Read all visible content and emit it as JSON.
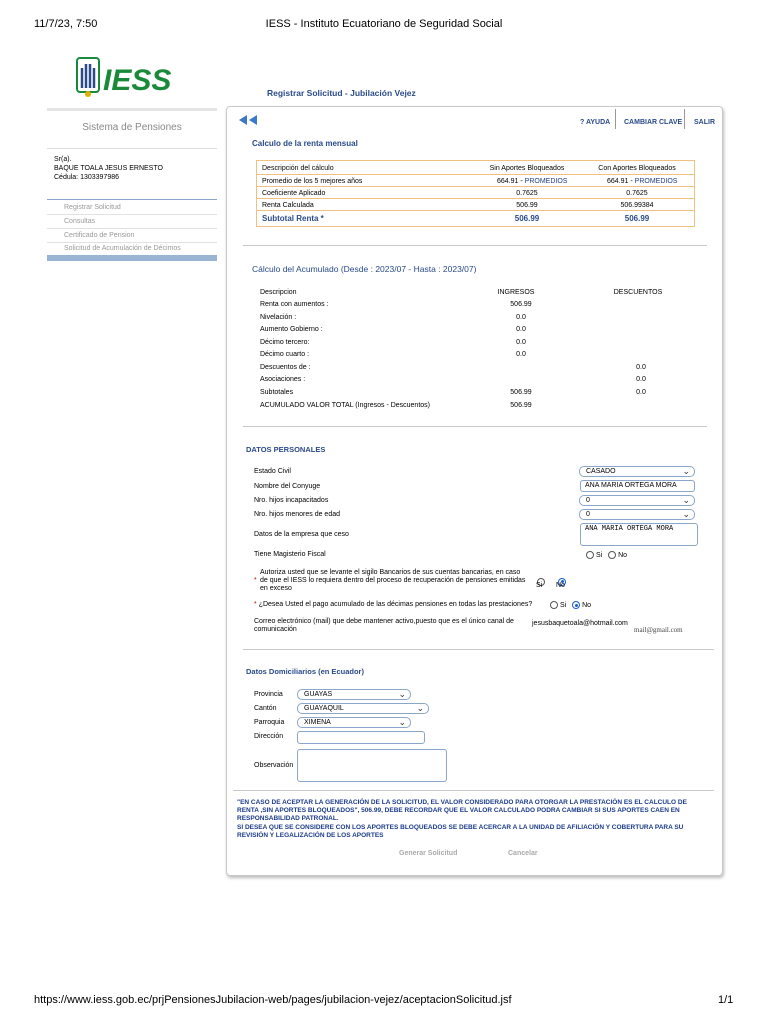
{
  "print_header": {
    "datetime": "11/7/23, 7:50",
    "title": "IESS - Instituto Ecuatoriano de Seguridad Social"
  },
  "print_footer": {
    "url": "https://www.iess.gob.ec/prjPensionesJubilacion-web/pages/jubilacion-vejez/aceptacionSolicitud.jsf",
    "page": "1/1"
  },
  "logo": {
    "text": "IESS"
  },
  "page_title": "Registrar Solicitud - Jubilación Vejez",
  "sidebar": {
    "system_name": "Sistema de Pensiones",
    "user_salutation": "Sr(a).",
    "user_name": "BAQUE TOALA JESUS ERNESTO",
    "user_id": "Cédula: 1303397986",
    "items": [
      {
        "label": "Registrar Solicitud"
      },
      {
        "label": "Consultas"
      },
      {
        "label": "Certificado de Pension"
      },
      {
        "label": "Solicitud de Acumulación de Décimos"
      }
    ]
  },
  "topnav": {
    "help": "? AYUDA",
    "change_password": "CAMBIAR CLAVE",
    "exit": "SALIR"
  },
  "renta": {
    "title": "Calculo de la renta mensual",
    "headers": [
      "Descripción del cálculo",
      "Sin Aportes Bloqueados",
      "Con Aportes Bloqueados"
    ],
    "rows": [
      {
        "label": "Promedio de los 5 mejores años",
        "sin": "664.91",
        "con": "664.91",
        "link": "PROMEDIOS"
      },
      {
        "label": "Coeficiente Aplicado",
        "sin": "0.7625",
        "con": "0.7625"
      },
      {
        "label": "Renta Calculada",
        "sin": "506.99",
        "con": "506.99384"
      }
    ],
    "subtotal_label": "Subtotal Renta *",
    "subtotal_sin": "506.99",
    "subtotal_con": "506.99"
  },
  "acumulado": {
    "title": "Cálculo del Acumulado (Desde : 2023/07 - Hasta : 2023/07)",
    "headers": [
      "Descripcion",
      "INGRESOS",
      "DESCUENTOS"
    ],
    "rows": [
      {
        "label": "Renta con aumentos :",
        "ing": "506.99",
        "desc": ""
      },
      {
        "label": "Nivelación :",
        "ing": "0.0",
        "desc": ""
      },
      {
        "label": "Aumento Gobierno :",
        "ing": "0.0",
        "desc": ""
      },
      {
        "label": "Décimo tercero:",
        "ing": "0.0",
        "desc": ""
      },
      {
        "label": "Décimo cuarto :",
        "ing": "0.0",
        "desc": ""
      },
      {
        "label": "Descuentos de :",
        "ing": "",
        "desc": "0.0"
      },
      {
        "label": "Asociaciones :",
        "ing": "",
        "desc": "0.0"
      },
      {
        "label": "Subtotales",
        "ing": "506.99",
        "desc": "0.0"
      },
      {
        "label": "ACUMULADO VALOR TOTAL (Ingresos - Descuentos)",
        "ing": "506.99",
        "desc": ""
      }
    ]
  },
  "personales": {
    "title": "DATOS PERSONALES",
    "estado_civil_label": "Estado Civil",
    "estado_civil": "CASADO",
    "conyuge_label": "Nombre del Conyuge",
    "conyuge": "ANA MARIA ORTEGA MORA",
    "hijos_inc_label": "Nro. hijos incapacitados",
    "hijos_inc": "0",
    "hijos_men_label": "Nro. hijos menores de edad",
    "hijos_men": "0",
    "empresa_label": "Datos de la empresa que ceso",
    "empresa": "ANA MARIA ORTEGA MORA",
    "magisterio_label": "Tiene Magisterio Fiscal",
    "si": "Si",
    "no": "No",
    "sigilo_text": "Autoriza usted que se levante el sigilo Bancarios de sus cuentas bancarias, en caso de que el IESS lo requiera dentro del proceso de recuperación de pensiones emitidas en exceso",
    "sigilo_si": "Si",
    "sigilo_no": "No",
    "decimas_text": "¿Desea Usted el pago acumulado de las décimas pensiones en todas las prestaciones?",
    "correo_label": "Correo electrónico (mail) que debe mantener activo,puesto que es el único canal de comunicación",
    "correo": "jesusbaquetoala@hotmail.com",
    "correo_hint": "mail@gmail.com"
  },
  "domicilio": {
    "title": "Datos Domiciliarios (en Ecuador)",
    "provincia_label": "Provincia",
    "provincia": "GUAYAS",
    "canton_label": "Cantón",
    "canton": "GUAYAQUIL",
    "parroquia_label": "Parroquia",
    "parroquia": "XIMENA",
    "direccion_label": "Dirección",
    "observacion_label": "Observación"
  },
  "notice": {
    "p1": "\"EN CASO DE ACEPTAR LA GENERACIÓN DE LA SOLICITUD, EL VALOR CONSIDERADO PARA OTORGAR LA PRESTACIÓN ES EL CALCULO DE RENTA ,SIN APORTES BLOQUEADOS\", 506.99, DEBE RECORDAR QUE EL VALOR CALCULADO PODRA CAMBIAR SI SUS APORTES CAEN EN RESPONSABILIDAD PATRONAL.",
    "p2": "SI DESEA QUE SE CONSIDERE CON LOS APORTES BLOQUEADOS SE DEBE ACERCAR A LA UNIDAD DE AFILIACIÓN Y COBERTURA PARA SU REVISIÓN Y LEGALIZACIÓN DE LOS APORTES"
  },
  "buttons": {
    "generate": "Generar Solicitud",
    "cancel": "Cancelar"
  },
  "colors": {
    "brand_green": "#1a8a3a",
    "brand_blue": "#2a4a8a",
    "link_blue": "#1f3c88",
    "accent_bar": "#9ab4d4"
  }
}
